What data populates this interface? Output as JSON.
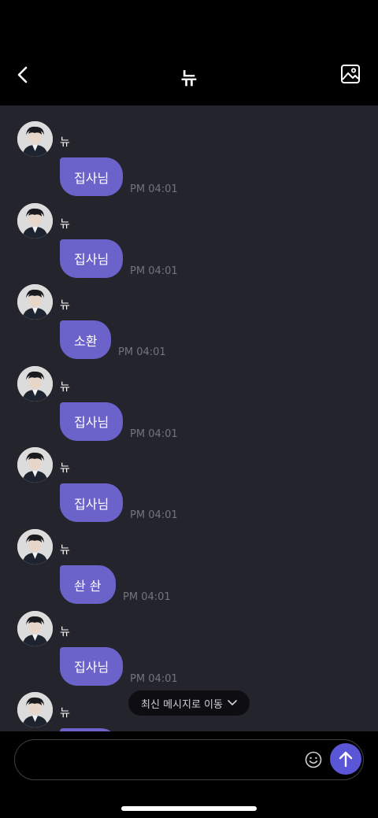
{
  "header": {
    "title": "뉴",
    "back_icon": "chevron-left-icon",
    "gallery_icon": "image-icon"
  },
  "messages": [
    {
      "sender": "뉴",
      "text": "집사님",
      "time": "PM 04:01"
    },
    {
      "sender": "뉴",
      "text": "집사님",
      "time": "PM 04:01"
    },
    {
      "sender": "뉴",
      "text": "소환",
      "time": "PM 04:01"
    },
    {
      "sender": "뉴",
      "text": "집사님",
      "time": "PM 04:01"
    },
    {
      "sender": "뉴",
      "text": "집사님",
      "time": "PM 04:01"
    },
    {
      "sender": "뉴",
      "text": "솬 솬",
      "time": "PM 04:01"
    },
    {
      "sender": "뉴",
      "text": "집사님",
      "time": "PM 04:01"
    },
    {
      "sender": "뉴",
      "text": "",
      "time": ""
    }
  ],
  "jump_to_latest": {
    "label": "최신 메시지로 이동"
  },
  "composer": {
    "value": "",
    "placeholder": "",
    "emoji_icon": "smiley-icon",
    "send_icon": "arrow-up-icon"
  },
  "colors": {
    "bubble": "#6b63c9",
    "send_button": "#5b55d8",
    "chat_background": "#24242d"
  }
}
